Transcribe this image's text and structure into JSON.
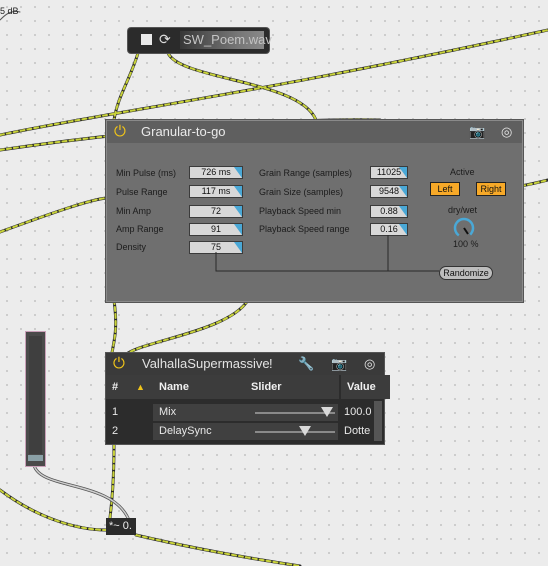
{
  "top_label": "5 dB",
  "sound_file": {
    "filename": "SW_Poem.wav"
  },
  "granular": {
    "title": "Granular-to-go",
    "params_left": [
      {
        "label": "Min Pulse (ms)",
        "value": "726 ms"
      },
      {
        "label": "Pulse Range",
        "value": "117 ms"
      },
      {
        "label": "Min Amp",
        "value": "72"
      },
      {
        "label": "Amp Range",
        "value": "91"
      },
      {
        "label": "Density",
        "value": "75"
      }
    ],
    "params_right": [
      {
        "label": "Grain Range (samples)",
        "value": "11025"
      },
      {
        "label": "Grain Size (samples)",
        "value": "9548"
      },
      {
        "label": "Playback Speed min",
        "value": "0.88"
      },
      {
        "label": "Playback Speed range",
        "value": "0.16"
      }
    ],
    "active_label": "Active",
    "left_label": "Left",
    "right_label": "Right",
    "drywet_label": "dry/wet",
    "drywet_value": "100 %",
    "drywet_level": 1.0,
    "randomize_label": "Randomize"
  },
  "valhalla": {
    "title": "ValhallaSupermassive",
    "columns": {
      "num": "#",
      "name": "Name",
      "slider": "Slider",
      "value": "Value"
    },
    "rows": [
      {
        "num": "1",
        "name": "Mix",
        "value": "100.0",
        "slider_level": 0.9
      },
      {
        "num": "2",
        "name": "DelaySync",
        "value": "Dotte",
        "slider_level": 0.62
      }
    ]
  },
  "multiplier": {
    "text": "*~ 0."
  },
  "colors": {
    "accent": "#f0c419",
    "toggle": "#f7a928",
    "cable": "#c8d23a",
    "numbox_tri": "#4aa8d6"
  }
}
